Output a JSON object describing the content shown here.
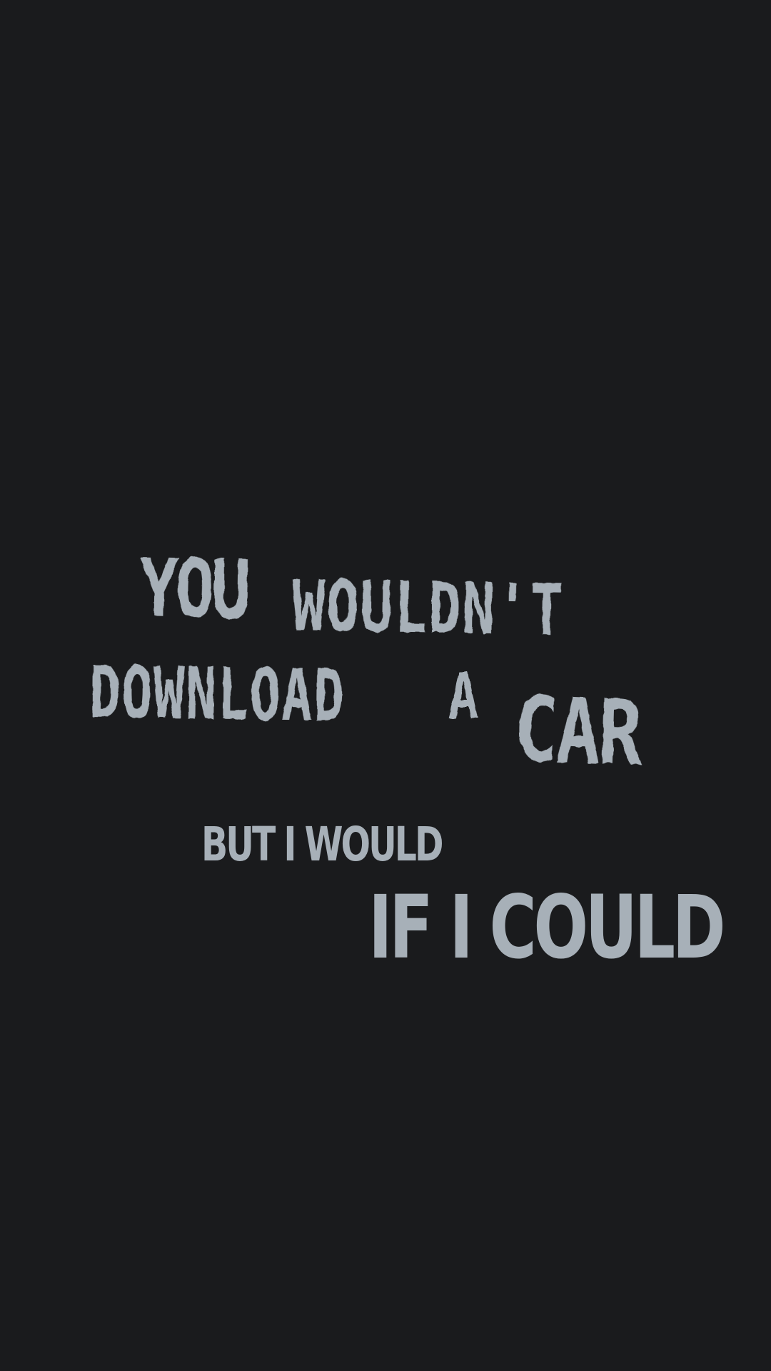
{
  "colors": {
    "background": "#1a1b1d",
    "text": "#a7b0b8"
  },
  "message": {
    "line1_word1": "YOU",
    "line1_word2": "WOULDN'T",
    "line2_word1": "DOWNLOAD",
    "line2_word2": "A",
    "line2_word3": "CAR",
    "line3": "BUT I WOULD",
    "line4": "IF I COULD"
  }
}
